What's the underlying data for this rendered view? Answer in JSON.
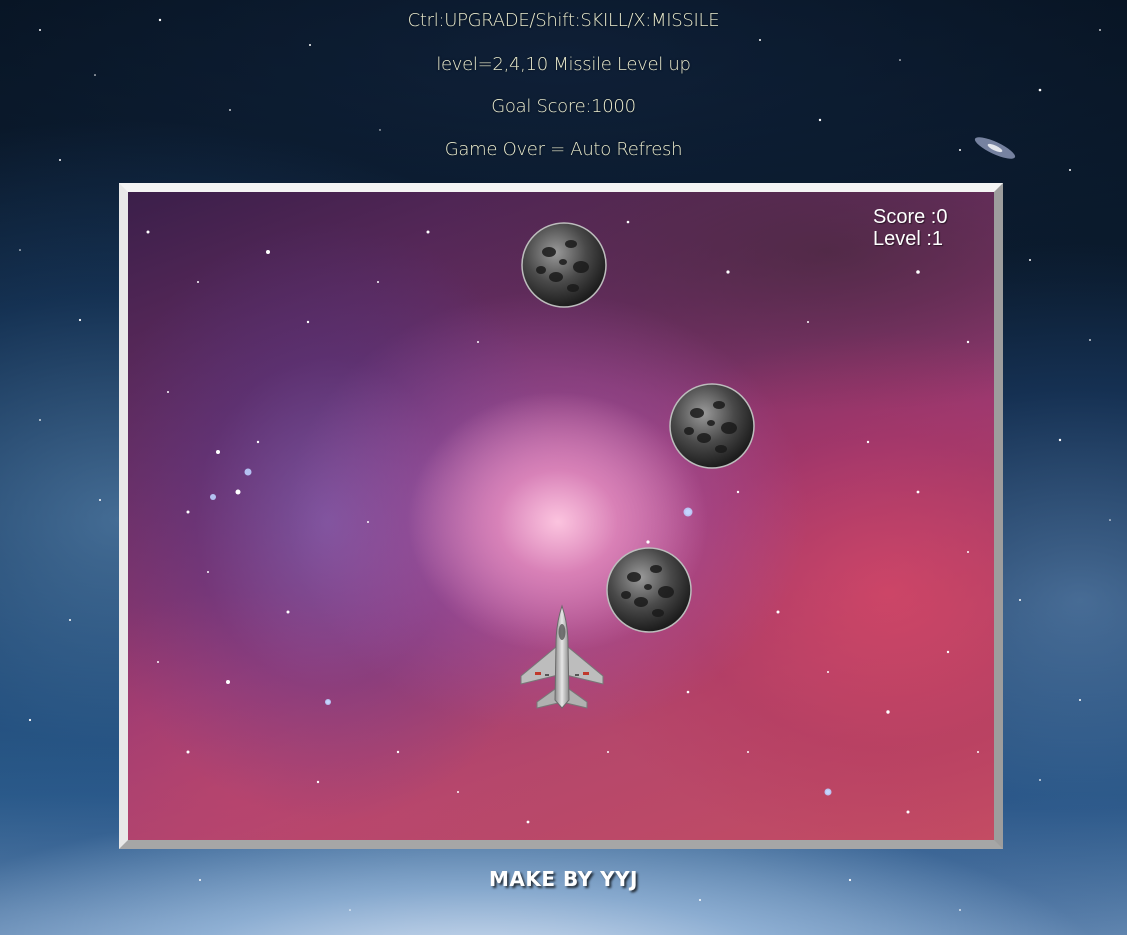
{
  "header": {
    "controls": "Ctrl:UPGRADE/Shift:SKILL/X:MISSILE",
    "missile_info": "level=2,4,10 Missile Level up",
    "goal": "Goal Score:1000",
    "game_over": "Game Over = Auto Refresh"
  },
  "hud": {
    "score": "Score :0",
    "level": "Level :1"
  },
  "game": {
    "score_value": 0,
    "level_value": 1,
    "asteroid_count": 3,
    "player_sprite": "fighter-jet-icon",
    "enemy_sprite": "asteroid-icon",
    "background": "nebula"
  },
  "footer": {
    "credit": "MAKE BY YYJ"
  },
  "colors": {
    "header_text": "#ecedcf",
    "hud_text": "#ffffff",
    "frame_light": "#f4f4f4",
    "frame_dark": "#9d9d9d"
  }
}
